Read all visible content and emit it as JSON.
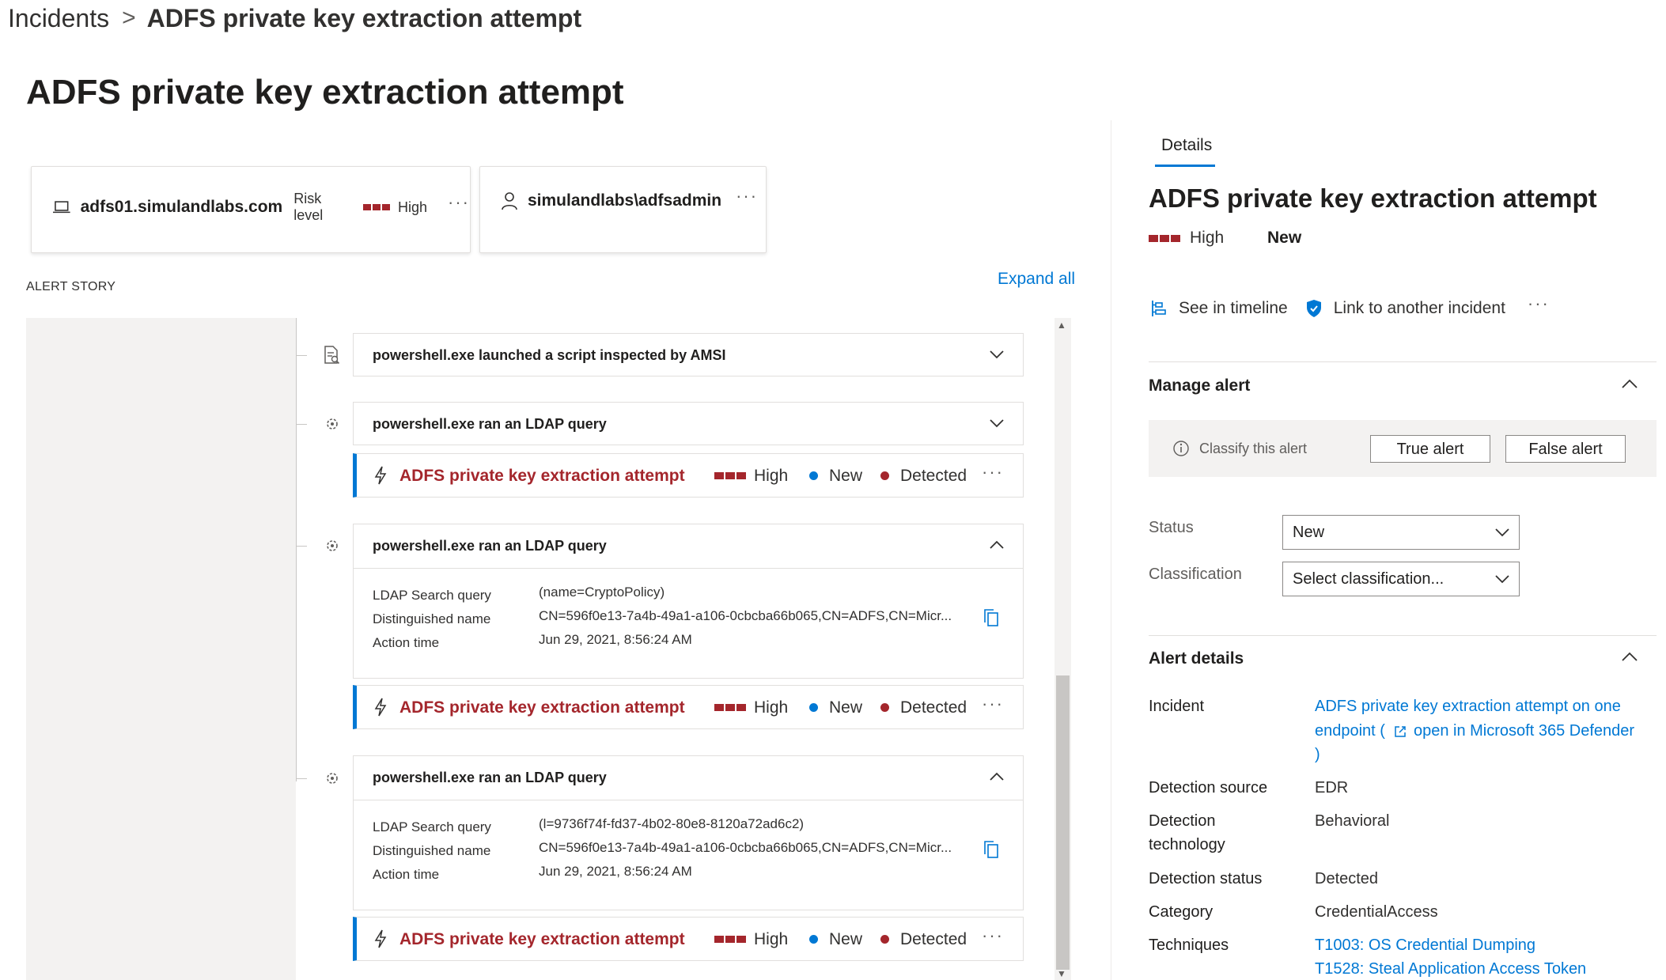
{
  "breadcrumb": {
    "parent": "Incidents",
    "separator": ">",
    "current": "ADFS private key extraction attempt"
  },
  "page_title": "ADFS private key extraction attempt",
  "entities": {
    "device": {
      "name": "adfs01.simulandlabs.com",
      "risk_label": "Risk level",
      "risk_value": "High",
      "more": "···",
      "icon": "laptop-icon"
    },
    "user": {
      "name": "simulandlabs\\adfsadmin",
      "more": "···",
      "icon": "user-icon"
    }
  },
  "alert_story": {
    "label": "ALERT STORY",
    "expand_all": "Expand all",
    "events": [
      {
        "title": "powershell.exe launched a script inspected by AMSI",
        "icon": "script-icon",
        "expanded": false
      },
      {
        "title": "powershell.exe ran an LDAP query",
        "icon": "query-gear-icon",
        "expanded": false
      },
      {
        "title": "powershell.exe ran an LDAP query",
        "icon": "query-gear-icon",
        "expanded": true,
        "details": [
          {
            "label": "LDAP Search query",
            "value": "(name=CryptoPolicy)"
          },
          {
            "label": "Distinguished name",
            "value": "CN=596f0e13-7a4b-49a1-a106-0cbcba66b065,CN=ADFS,CN=Micr..."
          },
          {
            "label": "Action time",
            "value": "Jun 29, 2021, 8:56:24 AM"
          }
        ]
      },
      {
        "title": "powershell.exe ran an LDAP query",
        "icon": "query-gear-icon",
        "expanded": true,
        "details": [
          {
            "label": "LDAP Search query",
            "value": "(l=9736f74f-fd37-4b02-80e8-8120a72ad6c2)"
          },
          {
            "label": "Distinguished name",
            "value": "CN=596f0e13-7a4b-49a1-a106-0cbcba66b065,CN=ADFS,CN=Micr..."
          },
          {
            "label": "Action time",
            "value": "Jun 29, 2021, 8:56:24 AM"
          }
        ]
      }
    ],
    "alerts": [
      {
        "title": "ADFS private key extraction attempt",
        "severity": "High",
        "status": "New",
        "detection": "Detected",
        "more": "···"
      },
      {
        "title": "ADFS private key extraction attempt",
        "severity": "High",
        "status": "New",
        "detection": "Detected",
        "more": "···"
      },
      {
        "title": "ADFS private key extraction attempt",
        "severity": "High",
        "status": "New",
        "detection": "Detected",
        "more": "···"
      }
    ]
  },
  "details_pane": {
    "tab": "Details",
    "title": "ADFS private key extraction attempt",
    "severity": "High",
    "status": "New",
    "actions": {
      "see_in_timeline": "See in timeline",
      "link_to_incident": "Link to another incident",
      "more": "···"
    },
    "manage_alert": {
      "title": "Manage alert",
      "classify_label": "Classify this alert",
      "true_alert": "True alert",
      "false_alert": "False alert",
      "status_label": "Status",
      "status_value": "New",
      "classification_label": "Classification",
      "classification_value": "Select classification..."
    },
    "alert_details": {
      "title": "Alert details",
      "incident_label": "Incident",
      "incident_link_1": "ADFS private key extraction attempt on one",
      "incident_link_2": "endpoint (",
      "incident_link_3": "open in Microsoft 365 Defender",
      "incident_link_4": ")",
      "detection_source_label": "Detection source",
      "detection_source_value": "EDR",
      "detection_technology_label_1": "Detection",
      "detection_technology_label_2": "technology",
      "detection_technology_value": "Behavioral",
      "detection_status_label": "Detection status",
      "detection_status_value": "Detected",
      "category_label": "Category",
      "category_value": "CredentialAccess",
      "techniques_label": "Techniques",
      "technique_1": "T1003: OS Credential Dumping",
      "technique_2": "T1528: Steal Application Access Token"
    }
  },
  "colors": {
    "accent": "#0078d4",
    "severity_high": "#a4262c",
    "status_new": "#0078d4"
  }
}
